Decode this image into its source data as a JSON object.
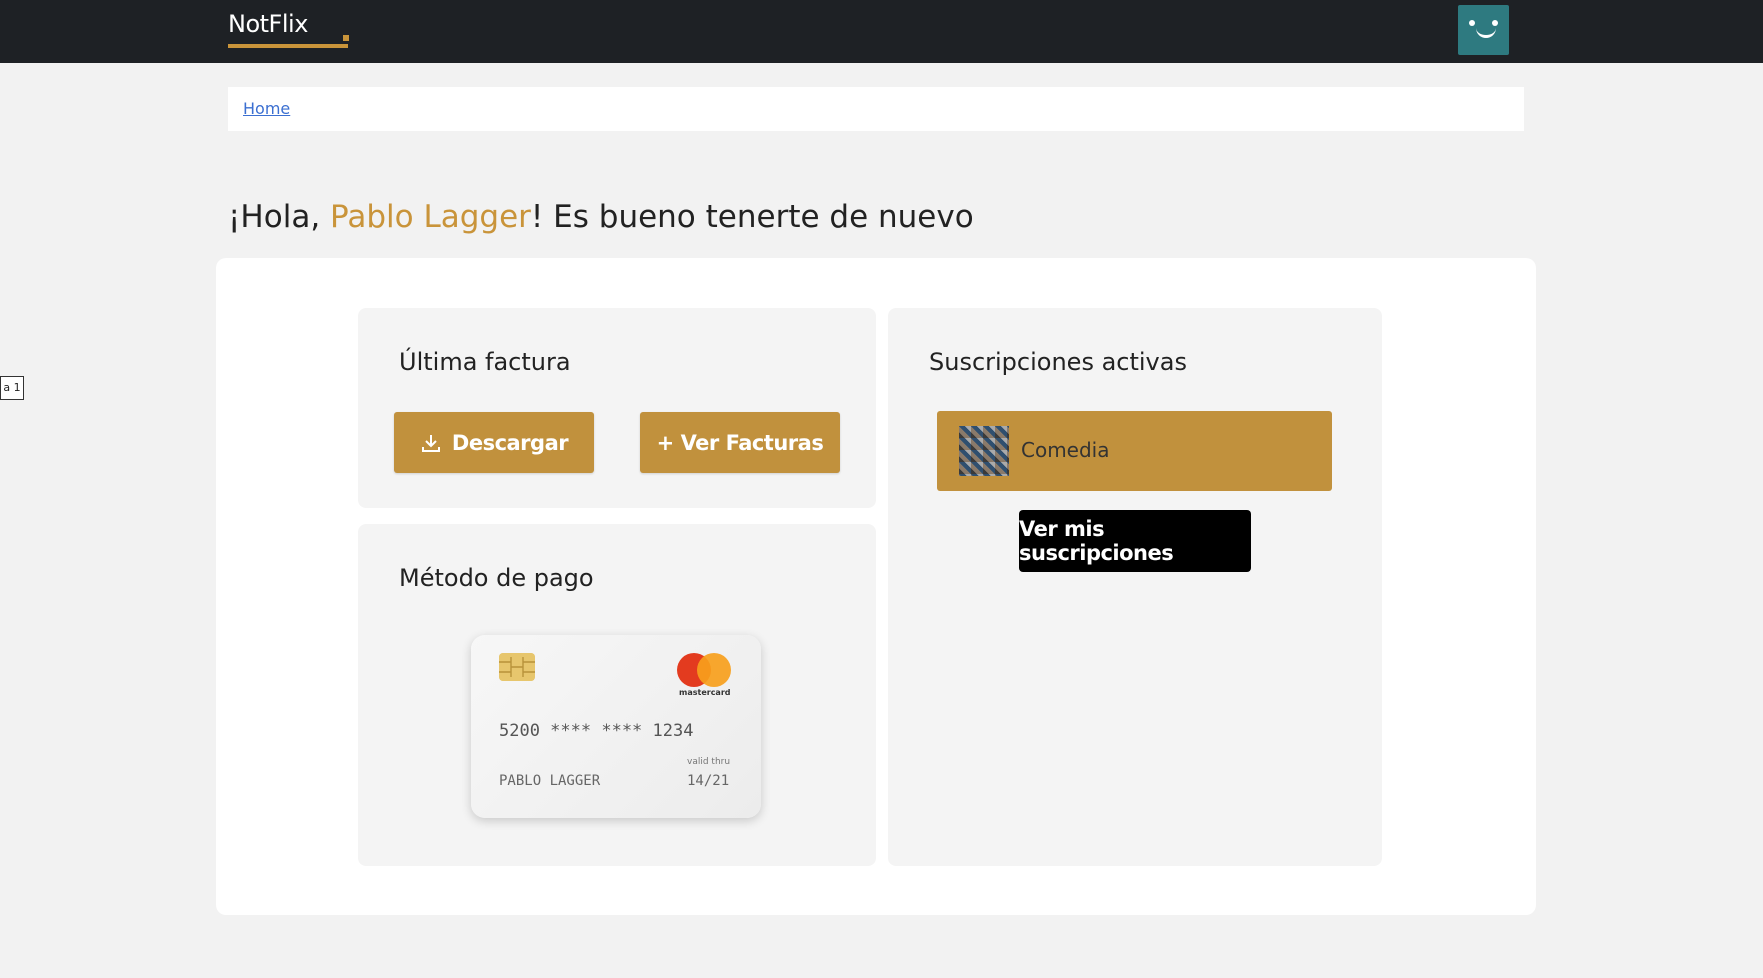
{
  "header": {
    "logo_text": "NotFlix"
  },
  "breadcrumb": {
    "home_label": "Home"
  },
  "greeting": {
    "prefix": "¡Hola, ",
    "user_name": "Pablo Lagger",
    "suffix": "! Es bueno tenerte de nuevo"
  },
  "side_tab": {
    "label": "a 1"
  },
  "invoice": {
    "title": "Última factura",
    "download_label": "Descargar",
    "view_label": "+ Ver Facturas"
  },
  "payment": {
    "title": "Método de pago",
    "card_number": "5200 **** **** 1234",
    "holder": "PABLO LAGGER",
    "valid_label": "valid thru",
    "expiry": "14/21",
    "brand_text": "mastercard"
  },
  "subscriptions": {
    "title": "Suscripciones activas",
    "items": [
      {
        "label": "Comedia"
      }
    ],
    "view_all_label": "Ver mis suscripciones"
  },
  "colors": {
    "accent": "#c1913d",
    "topbar": "#1e2125",
    "avatar": "#2e7a80"
  }
}
